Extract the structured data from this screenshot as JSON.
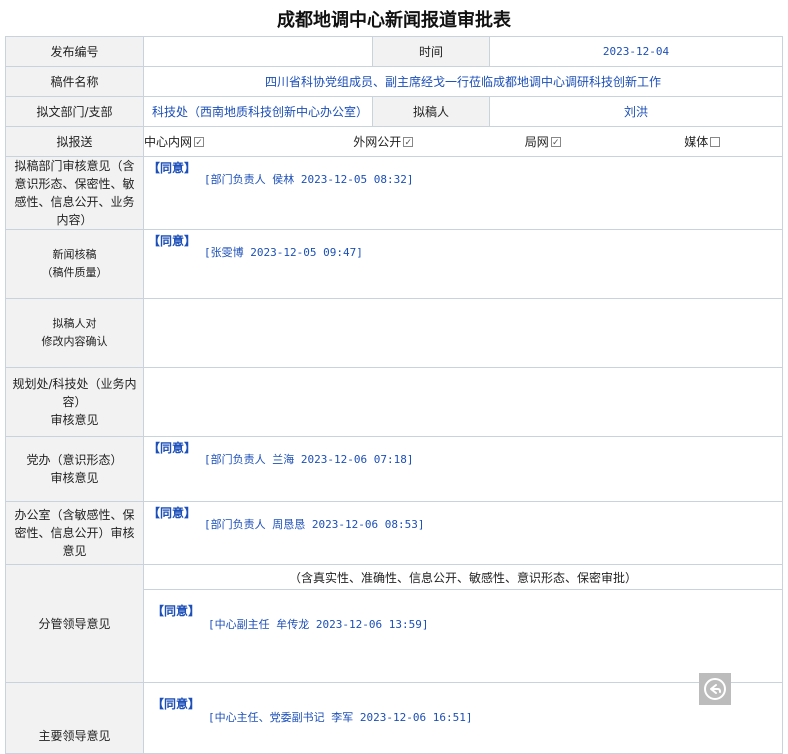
{
  "title": "成都地调中心新闻报道审批表",
  "labels": {
    "serial": "发布编号",
    "time": "时间",
    "manuscript": "稿件名称",
    "dept": "拟文部门/支部",
    "author": "拟稿人",
    "send": "拟报送",
    "dept_opinion": "拟稿部门审核意见（含意识形态、保密性、敏感性、信息公开、业务内容）",
    "news_review_1": "新闻核稿",
    "news_review_2": "（稿件质量）",
    "author_confirm_1": "拟稿人对",
    "author_confirm_2": "修改内容确认",
    "planning_1": "规划处/科技处（业务内容）",
    "planning_2": "审核意见",
    "party_1": "党办（意识形态）",
    "party_2": "审核意见",
    "office": "办公室（含敏感性、保密性、信息公开）审核意见",
    "leader": "分管领导意见",
    "main_leader": "主要领导意见"
  },
  "values": {
    "serial": "",
    "time": "2023-12-04",
    "manuscript": "四川省科协党组成员、副主席经戈一行莅临成都地调中心调研科技创新工作",
    "dept": "科技处（西南地质科技创新中心办公室）",
    "author": "刘洪"
  },
  "send_options": [
    {
      "label": "中心内网",
      "mark": "✓"
    },
    {
      "label": "外网公开",
      "mark": "✓"
    },
    {
      "label": "局网",
      "mark": "✓"
    },
    {
      "label": "媒体",
      "mark": ""
    }
  ],
  "opinions": {
    "dept": {
      "agree": "【同意】",
      "sign": "[部门负责人 侯林 2023-12-05 08:32]"
    },
    "news": {
      "agree": "【同意】",
      "sign": "[张雯博 2023-12-05 09:47]"
    },
    "party": {
      "agree": "【同意】",
      "sign": "[部门负责人 兰海 2023-12-06 07:18]"
    },
    "office": {
      "agree": "【同意】",
      "sign": "[部门负责人 周恳恳 2023-12-06 08:53]"
    },
    "leader_note": "（含真实性、准确性、信息公开、敏感性、意识形态、保密审批）",
    "leader": {
      "agree": "【同意】",
      "sign": "[中心副主任 牟传龙 2023-12-06 13:59]"
    },
    "main_leader": {
      "agree": "【同意】",
      "sign": "[中心主任、党委副书记 李军 2023-12-06 16:51]"
    }
  },
  "float_button": {
    "icon": "reply-icon"
  }
}
